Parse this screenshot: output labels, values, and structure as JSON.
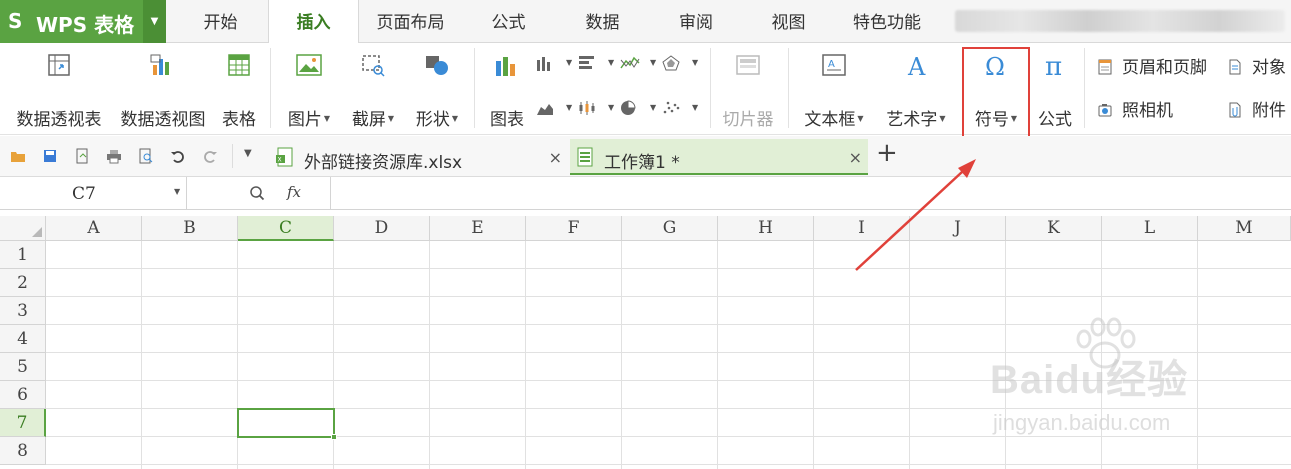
{
  "app": {
    "logo": "S",
    "name": "WPS 表格"
  },
  "menu": {
    "tabs": [
      {
        "label": "开始"
      },
      {
        "label": "插入",
        "active": true
      },
      {
        "label": "页面布局"
      },
      {
        "label": "公式"
      },
      {
        "label": "数据"
      },
      {
        "label": "审阅"
      },
      {
        "label": "视图"
      },
      {
        "label": "特色功能"
      }
    ]
  },
  "ribbon": {
    "pivot_table": "数据透视表",
    "pivot_chart": "数据透视图",
    "table": "表格",
    "picture": "图片",
    "screenshot": "截屏",
    "shapes": "形状",
    "chart": "图表",
    "slicer": "切片器",
    "textbox": "文本框",
    "wordart": "艺术字",
    "symbol": "符号",
    "equation": "公式",
    "header_footer": "页眉和页脚",
    "object": "对象",
    "camera": "照相机",
    "attachment": "附件"
  },
  "doc_tabs": [
    {
      "label": "外部链接资源库.xlsx",
      "close": "×"
    },
    {
      "label": "工作簿1 *",
      "close": "×",
      "active": true
    }
  ],
  "new_tab": "+",
  "formula_bar": {
    "name_box": "C7",
    "fx": "fx",
    "value": ""
  },
  "grid": {
    "columns": [
      "A",
      "B",
      "C",
      "D",
      "E",
      "F",
      "G",
      "H",
      "I",
      "J",
      "K",
      "L",
      "M"
    ],
    "rows": [
      "1",
      "2",
      "3",
      "4",
      "5",
      "6",
      "7",
      "8"
    ],
    "selected_column": "C",
    "selected_row": "7",
    "active_cell": "C7"
  },
  "colors": {
    "accent": "#5aa342",
    "highlight_box": "#e0413a",
    "arrow": "#e0413a"
  },
  "watermark": {
    "brand": "Baidu经验",
    "url": "jingyan.baidu.com"
  }
}
